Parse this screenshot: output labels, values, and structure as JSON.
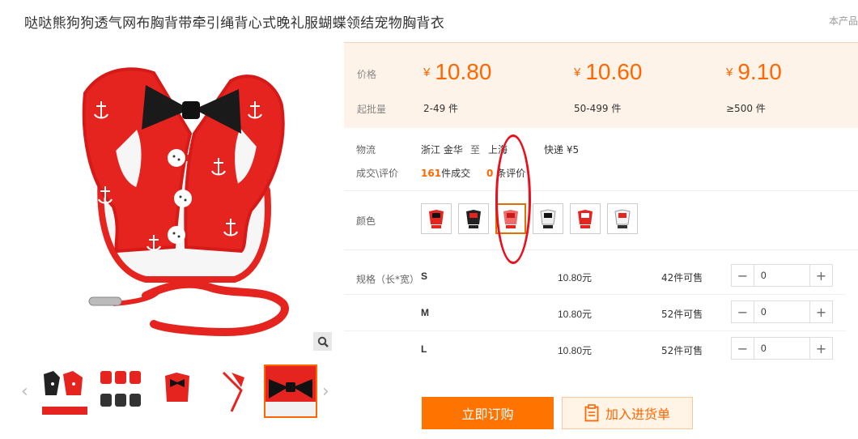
{
  "title": "哒哒熊狗狗透气网布胸背带牵引绳背心式晚礼服蝴蝶领结宠物胸背衣",
  "corner_link": "本产品",
  "price_box": {
    "price_label": "价格",
    "moq_label": "起批量",
    "currency": "¥",
    "tiers": [
      {
        "price": "10.80",
        "qty": "2-49 件"
      },
      {
        "price": "10.60",
        "qty": "50-499 件"
      },
      {
        "price": "9.10",
        "qty": "≥500 件"
      }
    ]
  },
  "logistics": {
    "label": "物流",
    "from": "浙江 金华",
    "to_word": "至",
    "to": "上海",
    "shipping": "快递 ¥5"
  },
  "deals": {
    "label": "成交\\评价",
    "sold_count": "161",
    "sold_suffix": "件成交",
    "review_count": "0",
    "review_suffix": "条评价"
  },
  "color": {
    "label": "颜色",
    "selected_index": 2,
    "swatches": [
      "red-black",
      "black-red",
      "pink-red",
      "white-black",
      "red-white",
      "white-red"
    ]
  },
  "specs": {
    "label": "规格（长*宽）",
    "rows": [
      {
        "size": "S",
        "price": "10.80元",
        "stock": "42件可售",
        "qty": "0"
      },
      {
        "size": "M",
        "price": "10.80元",
        "stock": "52件可售",
        "qty": "0"
      },
      {
        "size": "L",
        "price": "10.80元",
        "stock": "52件可售",
        "qty": "0"
      }
    ]
  },
  "actions": {
    "buy_label": "立即订购",
    "cart_label": "加入进货单"
  },
  "icons": {
    "zoom": "magnifier-icon",
    "prev": "chevron-left-icon",
    "next": "chevron-right-icon",
    "cart": "clipboard-icon",
    "minus": "minus-icon",
    "plus": "plus-icon"
  },
  "colors": {
    "accent": "#ff6600",
    "buy_bg": "#ff7300",
    "price_bg": "#fef3e9",
    "annotation": "#e8101c"
  }
}
